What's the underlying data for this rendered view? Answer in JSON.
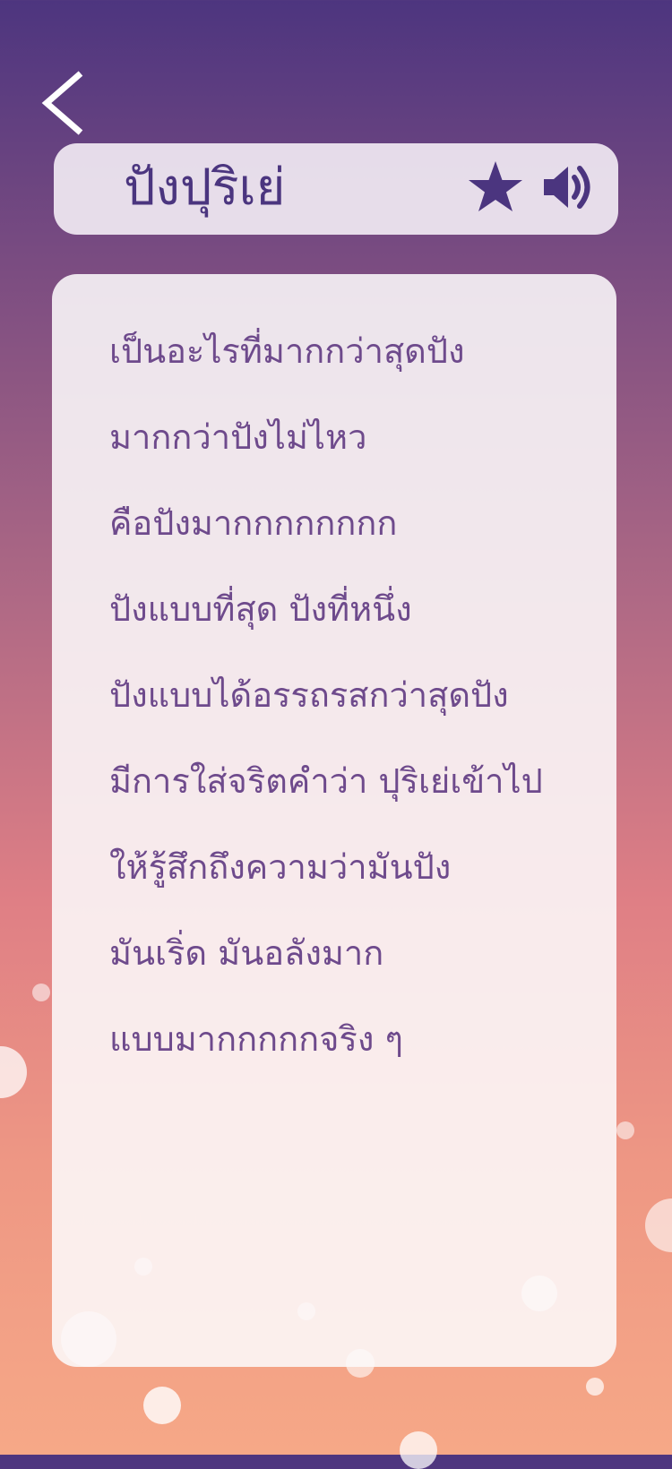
{
  "screen": {
    "colors": {
      "gradient_top": "#4d357f",
      "gradient_bottom": "#f6a887",
      "title_text": "#4b357f",
      "body_text": "#6e4a8c",
      "card_bg": "#fbf7fa"
    }
  },
  "nav": {
    "back_icon": "chevron-left-icon"
  },
  "header": {
    "title": "ปังปุริเย่",
    "favorite_icon": "star-icon",
    "audio_icon": "speaker-icon"
  },
  "definition": {
    "lines": [
      "เป็นอะไรที่มากกว่าสุดปัง",
      "มากกว่าปังไม่ไหว",
      "คือปังมากกกกกกกก",
      "ปังแบบที่สุด ปังที่หนึ่ง",
      "ปังแบบได้อรรถรสกว่าสุดปัง",
      "มีการใส่จริตคำว่า ปุริเย่เข้าไป",
      "ให้รู้สึกถึงความว่ามันปัง",
      "มันเริ่ด มันอลังมาก",
      "แบบมากกกกกจริง ๆ"
    ]
  }
}
